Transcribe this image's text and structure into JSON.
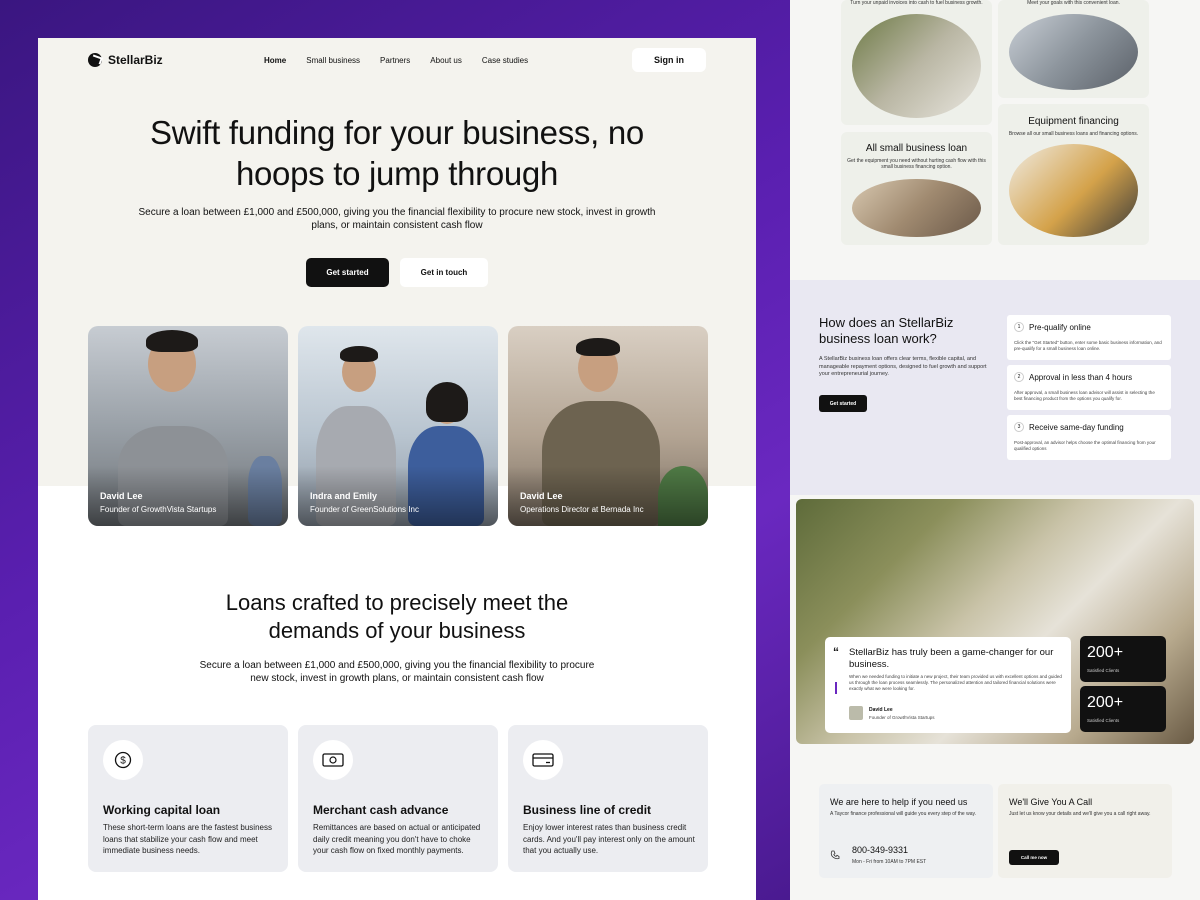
{
  "nav": {
    "brand": "StellarBiz",
    "links": [
      "Home",
      "Small business",
      "Partners",
      "About us",
      "Case studies"
    ],
    "signin": "Sign in"
  },
  "hero": {
    "title": "Swift funding for your business, no hoops to jump through",
    "subtitle": "Secure a loan between £1,000 and £500,000, giving you the financial flexibility to procure new stock, invest in growth plans, or maintain consistent cash flow",
    "primary_cta": "Get started",
    "secondary_cta": "Get in touch"
  },
  "people": [
    {
      "name": "David Lee",
      "role": "Founder of GrowthVista Startups"
    },
    {
      "name": "Indra and Emily",
      "role": "Founder of GreenSolutions Inc"
    },
    {
      "name": "David Lee",
      "role": "Operations Director at Bernada Inc"
    }
  ],
  "loans": {
    "title": "Loans crafted to precisely meet the demands of your business",
    "subtitle": "Secure a loan between £1,000 and £500,000, giving you the financial flexibility to procure new stock, invest in growth plans, or maintain consistent cash flow",
    "cards": [
      {
        "icon": "dollar-circle-icon",
        "title": "Working capital loan",
        "desc": "These short-term loans are the fastest business loans that stabilize your cash flow and meet immediate business needs."
      },
      {
        "icon": "banknote-icon",
        "title": "Merchant cash advance",
        "desc": "Remittances are based on actual or anticipated daily credit meaning you don't have to choke your cash flow on fixed monthly payments."
      },
      {
        "icon": "credit-card-icon",
        "title": "Business line of credit",
        "desc": "Enjoy lower interest rates than business credit cards. And you'll pay interest only on the amount that you actually use."
      }
    ]
  },
  "products": [
    {
      "caption": "Turn your unpaid invoices into cash to fuel business growth."
    },
    {
      "caption": "Meet your goals with this convenient loan."
    },
    {
      "title": "All small business loan",
      "caption": "Get the equipment you need without hurting cash flow with this small business financing option."
    },
    {
      "title": "Equipment financing",
      "caption": "Browse all our small business loans and financing options."
    }
  ],
  "how": {
    "title": "How does an StellarBiz business loan work?",
    "desc": "A StellarBiz business loan offers clear terms, flexible capital, and manageable repayment options, designed to fuel growth and support your entrepreneurial journey.",
    "cta": "Get started",
    "steps": [
      {
        "num": "1",
        "title": "Pre-qualify online",
        "desc": "Click the \"Get Started\" button, enter some basic business information, and pre-qualify for a small business loan online."
      },
      {
        "num": "2",
        "title": "Approval in less than 4 hours",
        "desc": "After approval, a small business loan advisor will assist in selecting the best financing product from the options you qualify for."
      },
      {
        "num": "3",
        "title": "Receive same-day funding",
        "desc": "Post-approval, an advisor helps choose the optimal financing from your qualified options"
      }
    ]
  },
  "testimonial": {
    "mark": "“",
    "heading": "StellarBiz has truly been a game-changer for our business.",
    "body": "When we needed funding to initiate a new project, their team provided us with excellent options and guided us through the loan process seamlessly. The personalized attention and tailored financial solutions were exactly what we were looking for.",
    "name": "David Lee",
    "role": "Founder of GrowthVista Startups",
    "stats": [
      {
        "value": "200+",
        "label": "Satisfied Clients"
      },
      {
        "value": "200+",
        "label": "Satisfied Clients"
      }
    ]
  },
  "contact": {
    "left": {
      "title": "We are here to help if you need us",
      "desc": "A Taycor finance professional will guide you every step of the way.",
      "phone": "800-349-9331",
      "hours": "Mon - Fri from 10AM to 7PM EST"
    },
    "right": {
      "title": "We'll Give You A Call",
      "desc": "Just let us know your details and we'll give you a call right away.",
      "cta": "Call me now"
    }
  }
}
